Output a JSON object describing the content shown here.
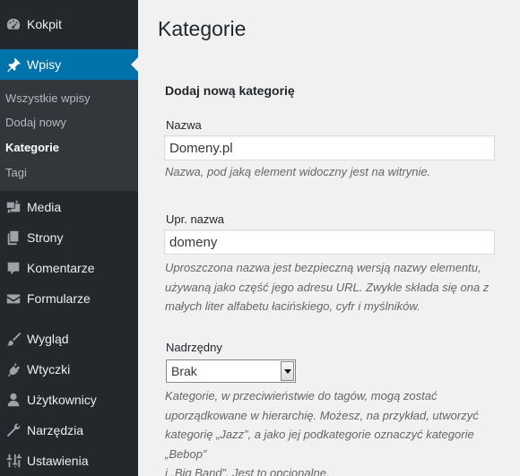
{
  "sidebar": {
    "items": [
      {
        "label": "Kokpit",
        "icon": "dashboard-icon"
      },
      {
        "label": "Wpisy",
        "icon": "pin-icon",
        "active": true
      },
      {
        "label": "Media",
        "icon": "media-icon"
      },
      {
        "label": "Strony",
        "icon": "pages-icon"
      },
      {
        "label": "Komentarze",
        "icon": "comments-icon"
      },
      {
        "label": "Formularze",
        "icon": "mail-icon"
      },
      {
        "label": "Wygląd",
        "icon": "brush-icon"
      },
      {
        "label": "Wtyczki",
        "icon": "plugin-icon"
      },
      {
        "label": "Użytkownicy",
        "icon": "user-icon"
      },
      {
        "label": "Narzędzia",
        "icon": "wrench-icon"
      },
      {
        "label": "Ustawienia",
        "icon": "settings-icon"
      }
    ],
    "submenu": [
      {
        "label": "Wszystkie wpisy"
      },
      {
        "label": "Dodaj nowy"
      },
      {
        "label": "Kategorie",
        "current": true
      },
      {
        "label": "Tagi"
      }
    ],
    "colors": {
      "background": "#23282d",
      "submenu_bg": "#32373c",
      "active": "#0073aa"
    }
  },
  "main": {
    "title": "Kategorie",
    "form_heading": "Dodaj nową kategorię",
    "name": {
      "label": "Nazwa",
      "value": "Domeny.pl",
      "help": "Nazwa, pod jaką element widoczny jest na witrynie."
    },
    "slug": {
      "label": "Upr. nazwa",
      "value": "domeny",
      "help_lines": [
        "Uproszczona nazwa jest bezpieczną wersją nazwy elementu,",
        "używaną jako część jego adresu URL. Zwykle składa się ona z",
        "małych liter alfabetu łacińskiego, cyfr i myślników."
      ]
    },
    "parent": {
      "label": "Nadrzędny",
      "selected": "Brak",
      "help_lines": [
        "Kategorie, w przeciwieństwie do tagów, mogą zostać",
        "uporządkowane w hierarchię. Możesz, na przykład, utworzyć",
        "kategorię „Jazz”, a jako jej podkategorie oznaczyć kategorie „Bebop”",
        "i „Big Band”. Jest to opcjonalne."
      ]
    }
  }
}
